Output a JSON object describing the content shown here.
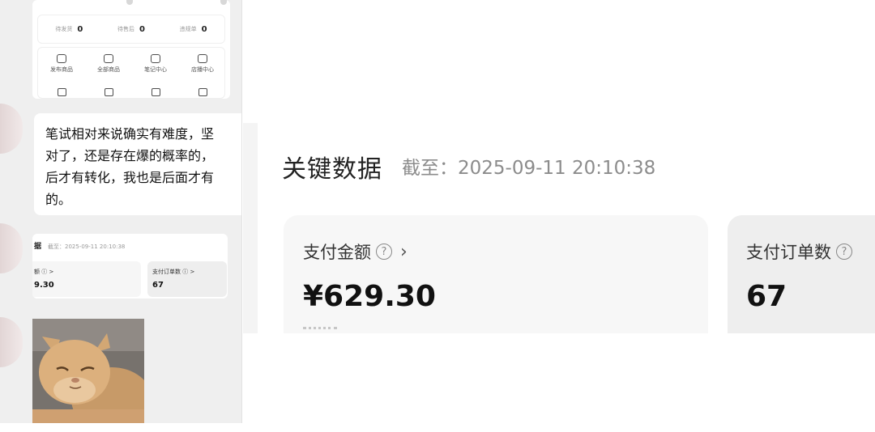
{
  "chat_screenshot": {
    "stats": [
      {
        "label": "待发货",
        "value": "0"
      },
      {
        "label": "待售后",
        "value": "0"
      },
      {
        "label": "违规单",
        "value": "0"
      }
    ],
    "tools": [
      "发布商品",
      "全部商品",
      "笔记中心",
      "店播中心"
    ]
  },
  "message": {
    "lines": [
      "笔试相对来说确实有难度，坚",
      "对了，还是存在爆的概率的，",
      "后才有转化，我也是后面才有",
      "的。"
    ]
  },
  "mini_data": {
    "title": "据",
    "date": "截至：2025-09-11 20:10:38",
    "card1_label": "额 ⓘ >",
    "card1_value": "9.30",
    "card2_label": "支付订单数 ⓘ >",
    "card2_value": "67"
  },
  "key_data": {
    "title": "关键数据",
    "as_of": "截至：2025-09-11 20:10:38",
    "cards": [
      {
        "label": "支付金额",
        "value": "¥629.30"
      },
      {
        "label": "支付订单数",
        "value": "67"
      }
    ]
  },
  "icons": {
    "help": "question-circle-icon",
    "chevron": "chevron-right-icon"
  }
}
